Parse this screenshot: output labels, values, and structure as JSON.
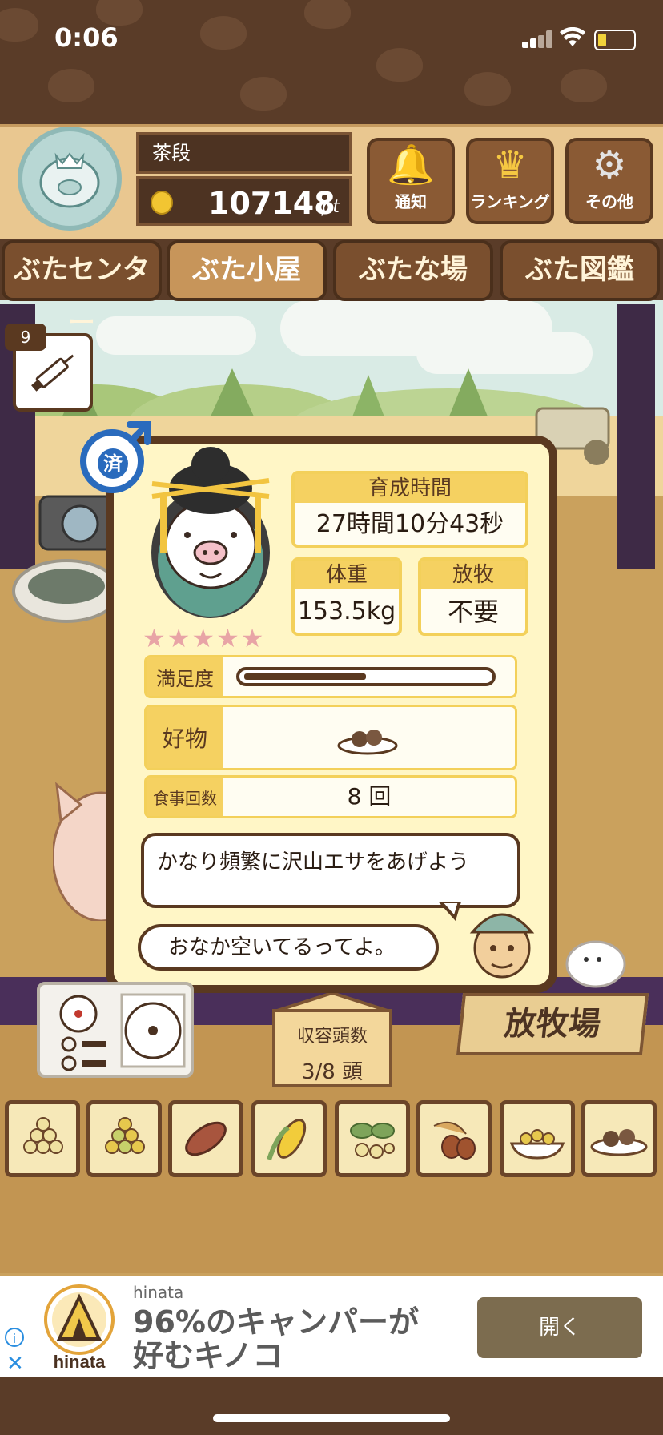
{
  "status_bar": {
    "time": "0:06"
  },
  "header": {
    "player_name": "茶段",
    "points": "107148",
    "points_unit": "pt",
    "buttons": [
      {
        "label": "通知",
        "icon": "bell-icon"
      },
      {
        "label": "ランキング",
        "icon": "crown-icon"
      },
      {
        "label": "その他",
        "icon": "gear-icon"
      }
    ]
  },
  "tabs": [
    {
      "label": "ぶたセンター"
    },
    {
      "label": "ぶた小屋"
    },
    {
      "label": "ぶたな場"
    },
    {
      "label": "ぶた図鑑"
    }
  ],
  "active_tab": "ぶた小屋",
  "syringe_count": "9",
  "pig_card": {
    "neutered_badge": "済",
    "rating_stars": 5,
    "growth_time_label": "育成時間",
    "growth_time_value": "27時間10分43秒",
    "weight_label": "体重",
    "weight_value": "153.5kg",
    "grazing_label": "放牧",
    "grazing_value": "不要",
    "satisfaction_label": "満足度",
    "satisfaction_level": 0.5,
    "favorite_label": "好物",
    "meal_count_label": "食事回数",
    "meal_count_value": "8 回",
    "advice": "かなり頻繁に沢山エサをあげよう",
    "pig_says": "おなか空いてるってよ。"
  },
  "bottom": {
    "capacity_label": "収容頭数",
    "capacity_value": "3/8 頭",
    "ranch_sign": "放牧場"
  },
  "foods": [
    "feed-1",
    "feed-2",
    "sweet-potato",
    "corn",
    "herbs",
    "acorns",
    "bean-bowl",
    "meatball-plate"
  ],
  "ad": {
    "brand": "hinata",
    "logo_text": "hinata",
    "headline_line1": "96%のキャンパーが",
    "headline_line2": "好むキノコ",
    "button": "開く"
  }
}
